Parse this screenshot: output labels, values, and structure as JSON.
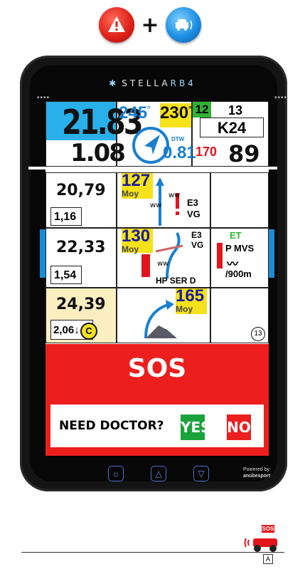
{
  "header": {
    "plus": "+",
    "red_button_icon": "warning-icon",
    "blue_button_icon": "car-icon"
  },
  "device": {
    "brand_name": "STELLA",
    "brand_model": "RB4",
    "powered_label": "Powered by",
    "powered_brand": "anubesport"
  },
  "top_panel": {
    "distance_main": "21.83",
    "distance_sub": "1.08",
    "heading_1": "245",
    "heading_1_unit": "°",
    "heading_2": "230",
    "heading_2_unit": "°",
    "waypoint_small": "12",
    "waypoint_total": "13",
    "zone_code": "K24",
    "dtw_label": "DTW",
    "dtw_value": "0.81",
    "speed_limit": "170",
    "speed": "89"
  },
  "rows": [
    {
      "distance": "20,79",
      "partial": "1,16",
      "heading": "127",
      "heading_sub": "Moy",
      "note_1": "E3",
      "note_2": "VG"
    },
    {
      "distance": "22,33",
      "partial": "1,54",
      "heading": "130",
      "heading_sub": "Moy",
      "note_1": "E3",
      "note_2": "VG",
      "note_3": "HP SER D",
      "side_title": "ET",
      "side_1": "P MVS",
      "side_2": "/900m"
    },
    {
      "distance": "24,39",
      "partial": "2,06",
      "caution_mark": "C",
      "heading": "165",
      "heading_sub": "Moy",
      "number_badge": "13"
    }
  ],
  "sos": {
    "label": "SOS",
    "question": "NEED DOCTOR?",
    "yes_label": "YES",
    "no_label": "NO"
  },
  "footer": {
    "sos_badge": "SOS",
    "signal_icon": "signal-icon",
    "vehicle_icon": "vehicle-icon",
    "marker": "A"
  },
  "colors": {
    "sos_red": "#ec1e1e",
    "highlight_blue": "#1b8cd6",
    "highlight_yellow": "#f5e21a",
    "yes_green": "#1aa33c"
  }
}
